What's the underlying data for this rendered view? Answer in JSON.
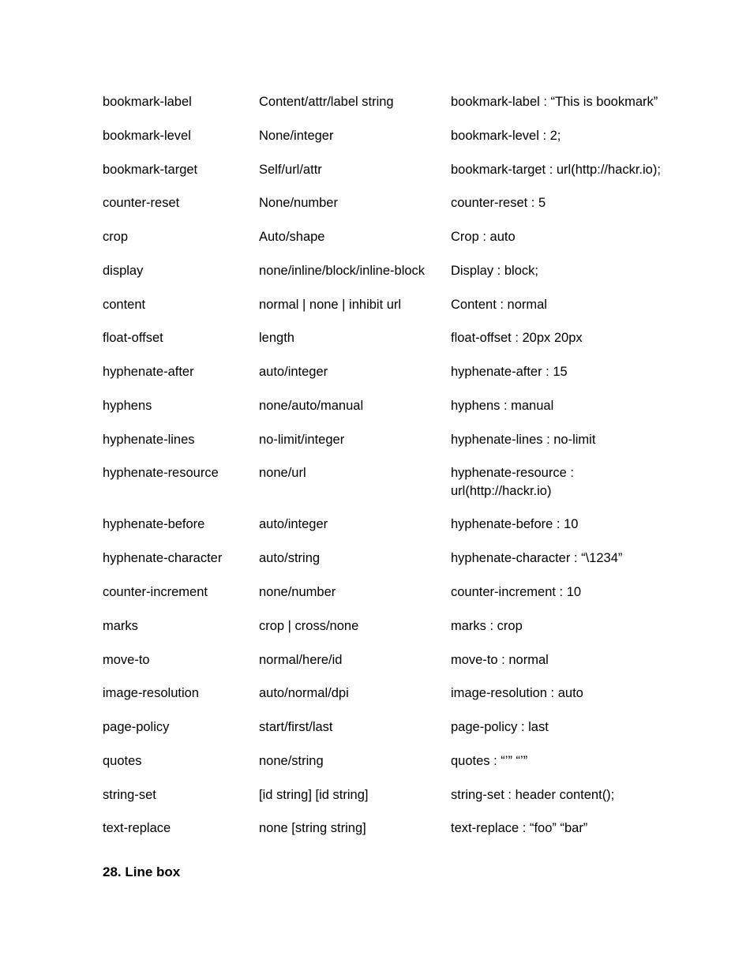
{
  "rows": [
    {
      "property": "bookmark-label",
      "values": "Content/attr/label string",
      "example": "bookmark-label : “This is bookmark”"
    },
    {
      "property": "bookmark-level",
      "values": "None/integer",
      "example": "bookmark-level : 2;"
    },
    {
      "property": "bookmark-target",
      "values": "Self/url/attr",
      "example": "bookmark-target : url(http://hackr.io);"
    },
    {
      "property": "counter-reset",
      "values": "None/number",
      "example": "counter-reset : 5"
    },
    {
      "property": "crop",
      "values": "Auto/shape",
      "example": "Crop : auto"
    },
    {
      "property": "display",
      "values": "none/inline/block/inline-block",
      "example": "Display : block;"
    },
    {
      "property": "content",
      "values": "normal | none | inhibit  url",
      "example": "Content : normal"
    },
    {
      "property": "float-offset",
      "values": "length",
      "example": "float-offset : 20px 20px"
    },
    {
      "property": "hyphenate-after",
      "values": "auto/integer",
      "example": "hyphenate-after : 15"
    },
    {
      "property": "hyphens",
      "values": "none/auto/manual",
      "example": "hyphens : manual"
    },
    {
      "property": "hyphenate-lines",
      "values": "no-limit/integer",
      "example": "hyphenate-lines : no-limit"
    },
    {
      "property": "hyphenate-resource",
      "values": "none/url",
      "example": "hyphenate-resource : url(http://hackr.io)"
    },
    {
      "property": "hyphenate-before",
      "values": "auto/integer",
      "example": "hyphenate-before : 10"
    },
    {
      "property": "hyphenate-character",
      "values": "auto/string",
      "example": "hyphenate-character : “\\1234”"
    },
    {
      "property": "counter-increment",
      "values": "none/number",
      "example": "counter-increment : 10"
    },
    {
      "property": "marks",
      "values": "crop | cross/none",
      "example": "marks : crop"
    },
    {
      "property": "move-to",
      "values": "normal/here/id",
      "example": "move-to : normal"
    },
    {
      "property": "image-resolution",
      "values": "auto/normal/dpi",
      "example": "image-resolution : auto"
    },
    {
      "property": "page-policy",
      "values": "start/first/last",
      "example": "page-policy : last"
    },
    {
      "property": "quotes",
      "values": "none/string",
      "example": "quotes : “’” “’”"
    },
    {
      "property": "string-set",
      "values": "[id string] [id string]",
      "example": "string-set : header content();"
    },
    {
      "property": "text-replace",
      "values": "none [string string]",
      "example": "text-replace : “foo” “bar”"
    }
  ],
  "heading": "28. Line box"
}
